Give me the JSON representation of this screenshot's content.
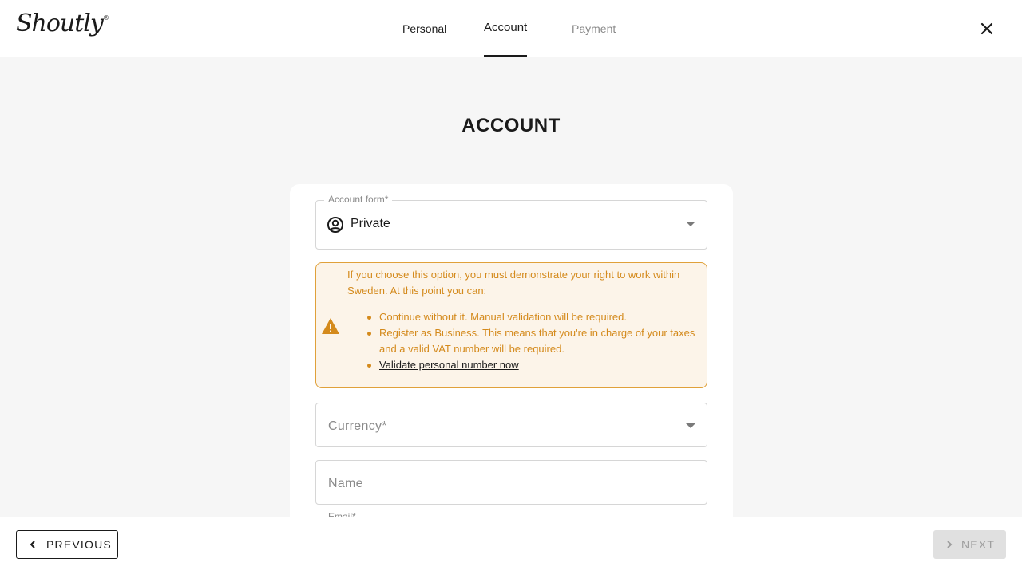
{
  "header": {
    "logo_text": "Shoutly",
    "logo_mark": "®",
    "tabs": [
      {
        "label": "Personal"
      },
      {
        "label": "Account"
      },
      {
        "label": "Payment"
      }
    ],
    "active_tab": "Account",
    "close_icon": "close-icon"
  },
  "main": {
    "title": "ACCOUNT",
    "account_form": {
      "label": "Account form*",
      "value": "Private",
      "icon": "user-circle-icon"
    },
    "alert": {
      "icon": "warning-icon",
      "intro": "If you choose this option, you must demonstrate your right to work within Sweden. At this point you can:",
      "items": [
        "Continue without it. Manual validation will be required.",
        "Register as Business. This means that you're in charge of your taxes and a valid VAT number will be required."
      ],
      "link": "Validate personal number now"
    },
    "currency": {
      "placeholder": "Currency*"
    },
    "name": {
      "placeholder": "Name"
    },
    "email": {
      "label": "Email*"
    }
  },
  "footer": {
    "previous_label": "PREVIOUS",
    "next_label": "NEXT"
  },
  "colors": {
    "warning": "#d48a1c",
    "warning_bg": "#fcf4e9",
    "text": "#1a1a1a",
    "background": "#f6f6f6"
  }
}
